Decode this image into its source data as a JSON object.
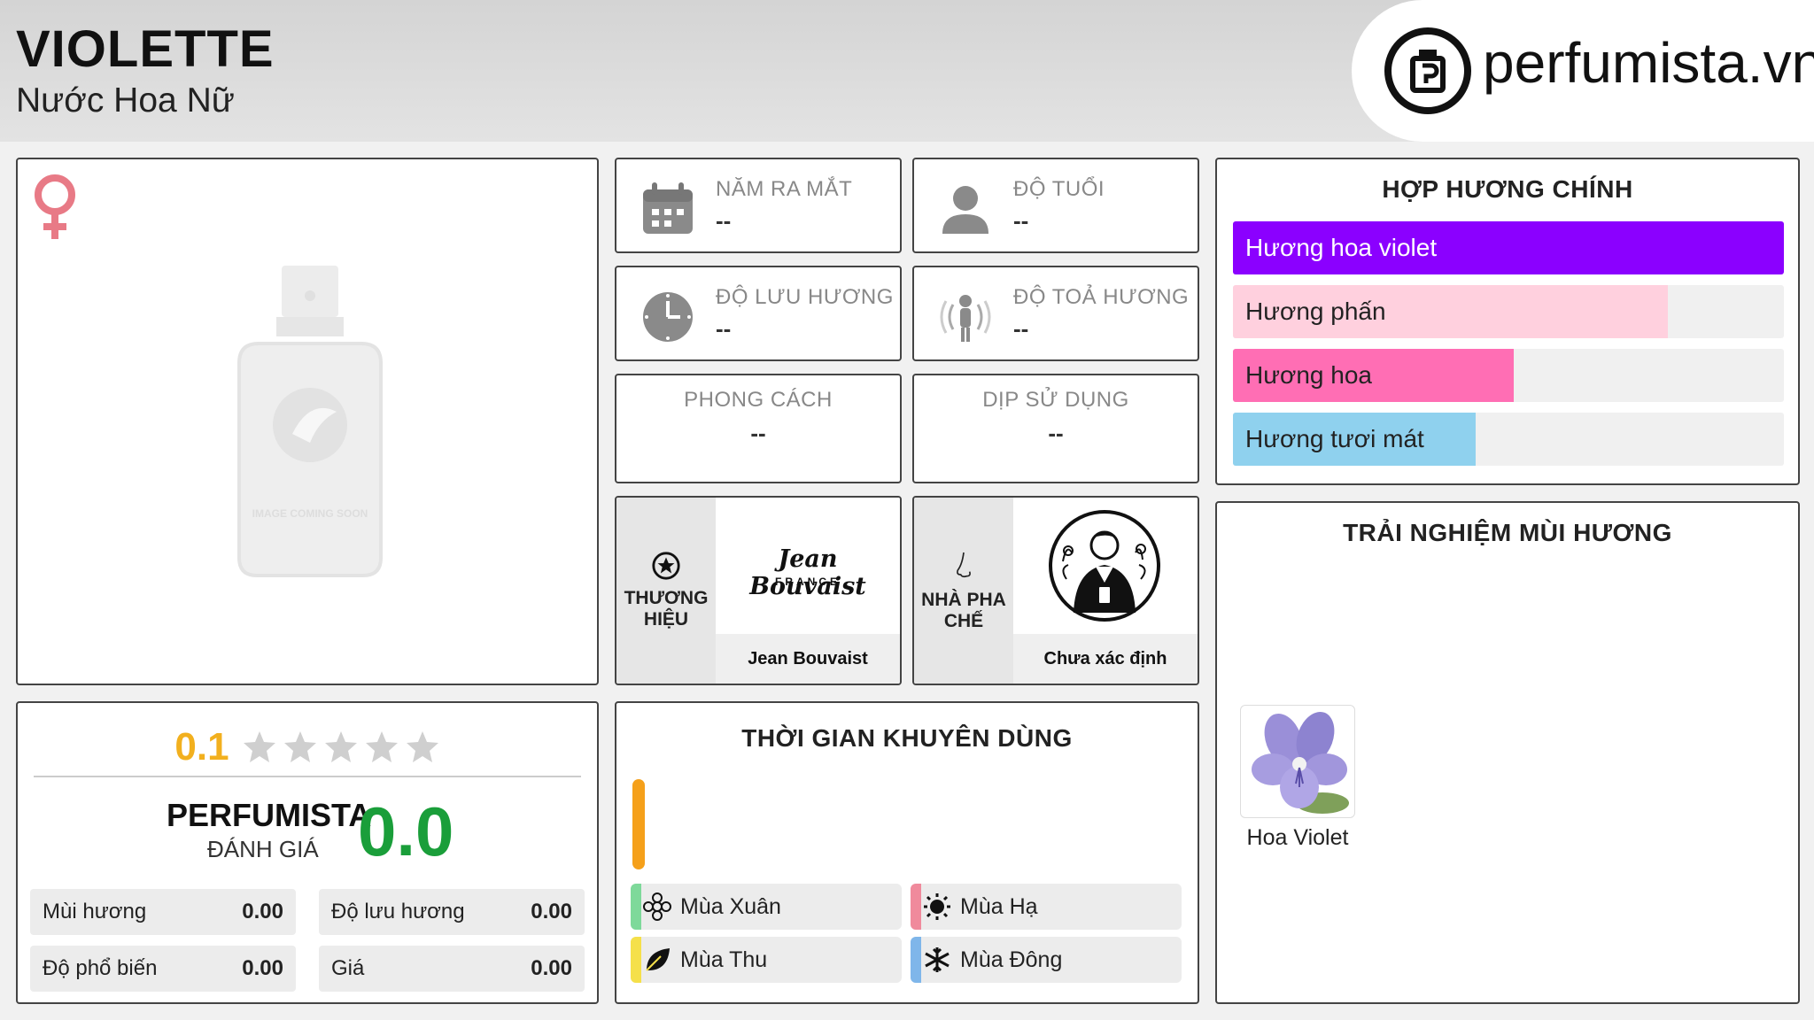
{
  "header": {
    "title": "VIOLETTE",
    "subtitle": "Nước Hoa Nữ",
    "logo_text": "perfumista.vn"
  },
  "product_image": {
    "gender_icon": "female-icon",
    "placeholder_text": "IMAGE COMING SOON"
  },
  "info": {
    "launch_year": {
      "label": "NĂM RA MẮT",
      "value": "--",
      "icon": "calendar-icon"
    },
    "age": {
      "label": "ĐỘ TUỔI",
      "value": "--",
      "icon": "person-icon"
    },
    "longevity": {
      "label": "ĐỘ LƯU HƯƠNG",
      "value": "--",
      "icon": "clock-icon"
    },
    "sillage": {
      "label": "ĐỘ TOẢ HƯƠNG",
      "value": "--",
      "icon": "sillage-person-icon"
    },
    "style": {
      "label": "PHONG CÁCH",
      "value": "--"
    },
    "occasion": {
      "label": "DỊP SỬ DỤNG",
      "value": "--"
    },
    "brand": {
      "label_line1": "THƯƠNG",
      "label_line2": "HIỆU",
      "logo_line1": "Jean Bouvaist",
      "logo_line2": "FRANCE",
      "name": "Jean Bouvaist",
      "icon": "star-circle-icon"
    },
    "perfumer": {
      "label_line1": "NHÀ PHA",
      "label_line2": "CHẾ",
      "name": "Chưa xác định",
      "icon": "nose-icon"
    }
  },
  "accords": {
    "title": "HỢP HƯƠNG CHÍNH",
    "items": [
      {
        "label": "Hương hoa violet",
        "value": 100,
        "color": "#8b00ff"
      },
      {
        "label": "Hương phấn",
        "value": 79,
        "color": "#ffd0de"
      },
      {
        "label": "Hương hoa",
        "value": 51,
        "color": "#ff6eb4"
      },
      {
        "label": "Hương tươi mát",
        "value": 44,
        "color": "#8fd1ee"
      }
    ]
  },
  "experience": {
    "title": "TRẢI NGHIỆM MÙI HƯƠNG",
    "notes": [
      {
        "name": "Hoa Violet",
        "icon": "violet-flower-icon"
      }
    ]
  },
  "rating": {
    "score": "0.1",
    "stars_filled": 0,
    "brand_label": "PERFUMISTA",
    "review_label": "ĐÁNH GIÁ",
    "big_score": "0.0",
    "metrics": [
      {
        "label": "Mùi hương",
        "value": "0.00"
      },
      {
        "label": "Độ lưu hương",
        "value": "0.00"
      },
      {
        "label": "Độ phổ biến",
        "value": "0.00"
      },
      {
        "label": "Giá",
        "value": "0.00"
      }
    ],
    "colors": {
      "score": "#f2b01e",
      "big_score": "#1a9e3a"
    }
  },
  "usage": {
    "title": "THỜI GIAN KHUYÊN DÙNG",
    "seasons": [
      {
        "label": "Mùa Xuân",
        "color": "#7ed99a",
        "icon": "flower-outline-icon"
      },
      {
        "label": "Mùa Hạ",
        "color": "#f08a9c",
        "icon": "sun-icon"
      },
      {
        "label": "Mùa Thu",
        "color": "#f5e04a",
        "icon": "leaf-icon"
      },
      {
        "label": "Mùa Đông",
        "color": "#7fb6ea",
        "icon": "snowflake-icon"
      }
    ],
    "indicator_color": "#f5a01a"
  }
}
